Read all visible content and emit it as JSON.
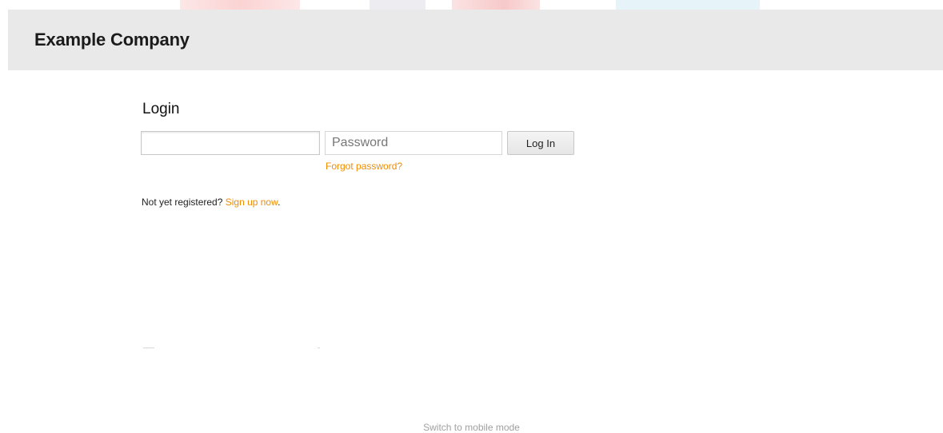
{
  "header": {
    "company_name": "Example Company"
  },
  "login": {
    "title": "Login",
    "username": {
      "value": "",
      "placeholder": ""
    },
    "password": {
      "value": "",
      "placeholder": "Password"
    },
    "submit_label": "Log In",
    "forgot_label": "Forgot password?"
  },
  "register": {
    "prompt": "Not yet registered? ",
    "link_label": "Sign up now",
    "suffix": "."
  },
  "footer": {
    "mobile_link": "Switch to mobile mode"
  },
  "colors": {
    "header_bg": "#e9e9e9",
    "link": "#f08c00",
    "muted": "#a0a0a0"
  }
}
